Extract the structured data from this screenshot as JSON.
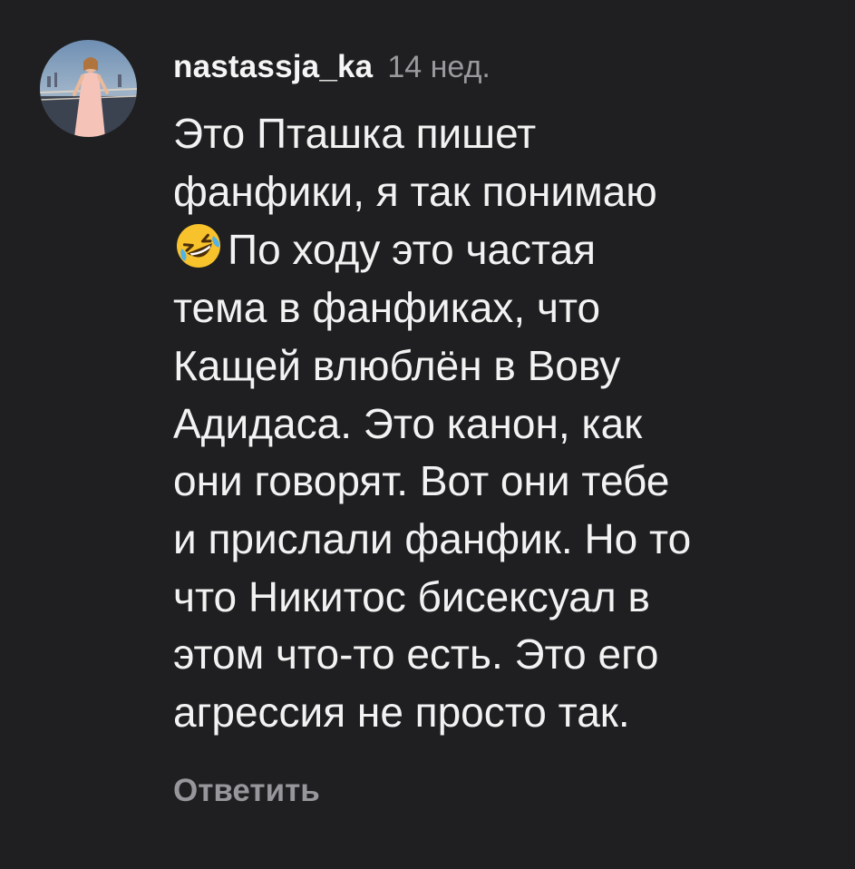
{
  "comment": {
    "username": "nastassja_ka",
    "timestamp": "14 нед.",
    "emoji": "rolling-on-the-floor-laughing",
    "text_first_line": "Это Пташка пишет\nфанфики, я так понимаю",
    "text_after_emoji": "По ходу это частая\nтема в фанфиках, что\nКащей влюблён в Вову\nАдидаса. Это канон, как\nони говорят. Вот они тебе\nи прислали фанфик. Но то\nчто Никитос бисексуал в\nэтом что-то есть. Это его\nагрессия не просто так.",
    "reply_label": "Ответить"
  },
  "colors": {
    "background": "#1f1f21",
    "text": "#f2f2f2",
    "muted": "#9a9a9e"
  }
}
